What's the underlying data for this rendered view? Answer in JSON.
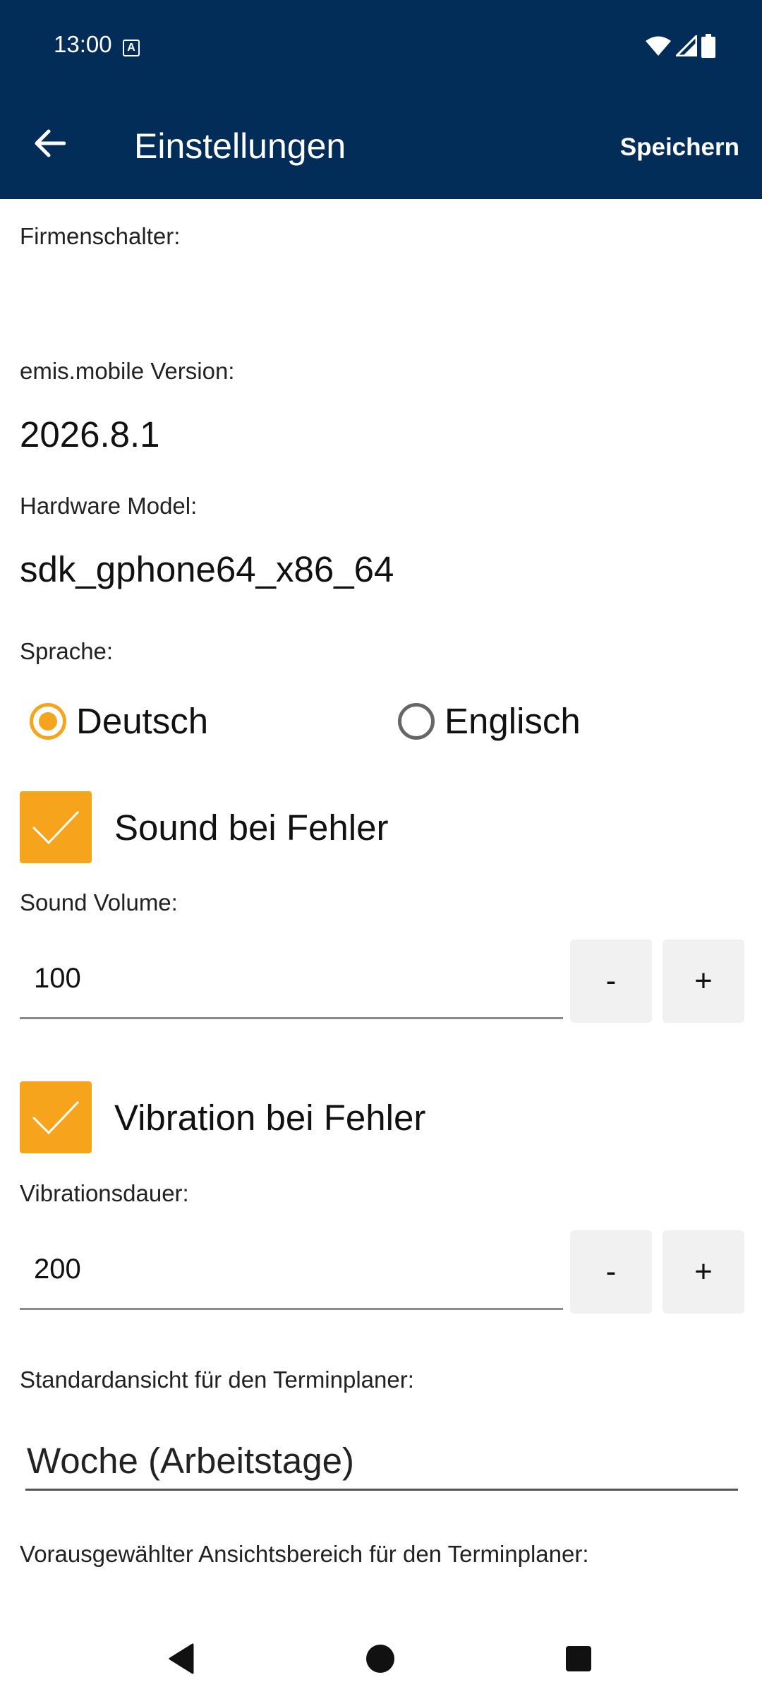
{
  "status_bar": {
    "time": "13:00",
    "a_badge": "A"
  },
  "app_bar": {
    "title": "Einstellungen",
    "save_label": "Speichern"
  },
  "settings": {
    "company_switch_label": "Firmenschalter:",
    "version_label": "emis.mobile Version:",
    "version_value": "2026.8.1",
    "hardware_label": "Hardware Model:",
    "hardware_value": "sdk_gphone64_x86_64",
    "language_label": "Sprache:",
    "language_options": [
      "Deutsch",
      "Englisch"
    ],
    "language_selected": "Deutsch",
    "sound_on_error_label": "Sound bei Fehler",
    "sound_on_error_checked": true,
    "sound_volume_label": "Sound Volume:",
    "sound_volume_value": "100",
    "vibration_on_error_label": "Vibration bei Fehler",
    "vibration_on_error_checked": true,
    "vibration_duration_label": "Vibrationsdauer:",
    "vibration_duration_value": "200",
    "minus_label": "-",
    "plus_label": "+",
    "planner_default_view_label": "Standardansicht für den Terminplaner:",
    "planner_default_view_value": "Woche (Arbeitstage)",
    "planner_preselected_range_label": "Vorausgewählter Ansichtsbereich für den Terminplaner:"
  },
  "colors": {
    "app_bar": "#032d59",
    "accent": "#f5a41c",
    "step_button_bg": "#f1f1f1"
  }
}
